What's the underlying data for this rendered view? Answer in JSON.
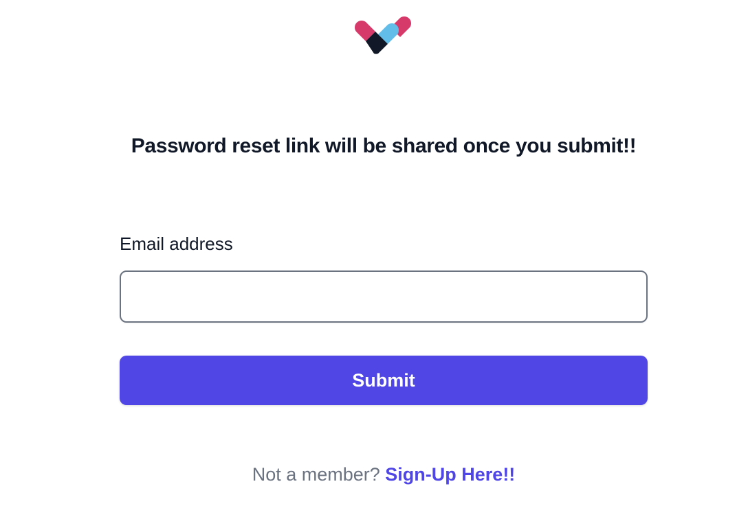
{
  "logo": {
    "icon": "heart-pill-logo-icon",
    "colors": {
      "pink": "#d63a6a",
      "light_blue": "#62bde9",
      "dark_navy": "#111827"
    }
  },
  "heading": "Password reset link will be shared once you submit!!",
  "form": {
    "email_label": "Email address",
    "email_value": "",
    "email_placeholder": "",
    "submit_label": "Submit"
  },
  "footer": {
    "prompt": "Not a member?",
    "signup_link": "Sign-Up Here!!"
  },
  "colors": {
    "accent": "#4f46e5",
    "text_primary": "#111827",
    "text_muted": "#6b7280"
  }
}
